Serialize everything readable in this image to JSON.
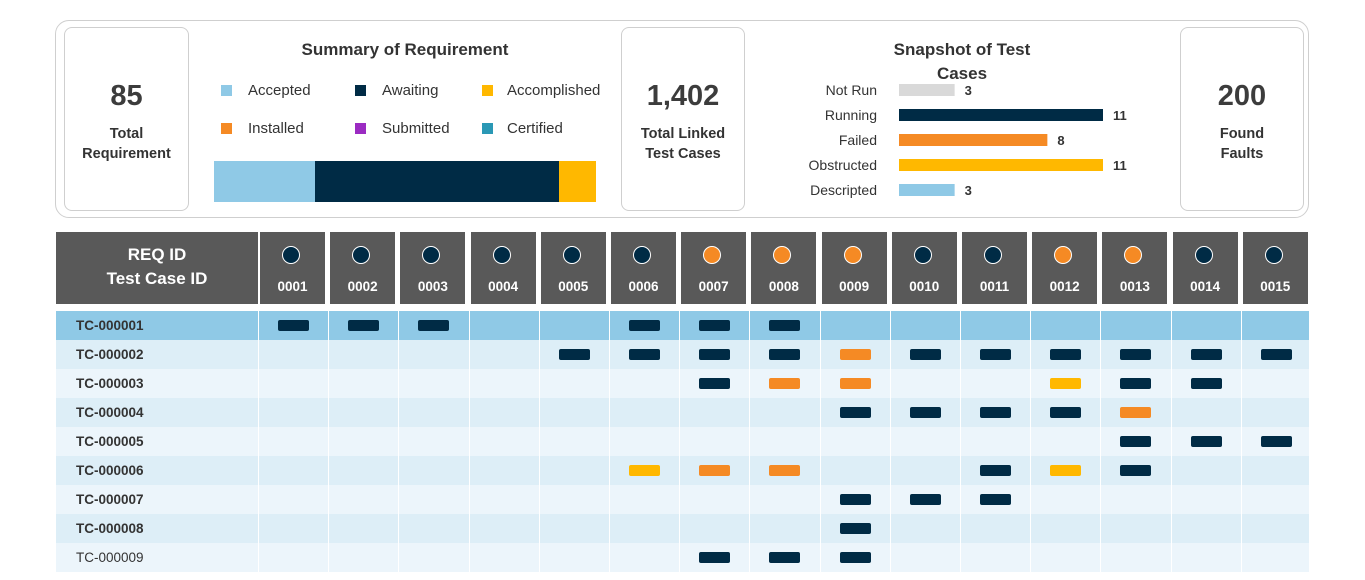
{
  "colors": {
    "accepted": "#8fc9e6",
    "awaiting": "#002b45",
    "accomplished": "#ffb800",
    "installed": "#f58a24",
    "submitted": "#9b2bc2",
    "certified": "#2a98b5",
    "not_run": "#d9d9d9",
    "header_bg": "#595959",
    "row_even": "#ddeef7",
    "row_odd": "#ecf5fb",
    "row_highlight": "#8fc9e6"
  },
  "kpis": [
    {
      "value": "85",
      "label": "Total Requirement"
    },
    {
      "value": "1,402",
      "label": "Total Linked Test Cases"
    },
    {
      "value": "200",
      "label": "Found Faults"
    }
  ],
  "summary": {
    "title": "Summary of Requirement",
    "legend": [
      {
        "label": "Accepted",
        "color": "#8fc9e6"
      },
      {
        "label": "Awaiting",
        "color": "#002b45"
      },
      {
        "label": "Accomplished",
        "color": "#ffb800"
      },
      {
        "label": "Installed",
        "color": "#f58a24"
      },
      {
        "label": "Submitted",
        "color": "#9b2bc2"
      },
      {
        "label": "Certified",
        "color": "#2a98b5"
      }
    ]
  },
  "snapshot": {
    "title": "Snapshot of Test Cases"
  },
  "chart_data": [
    {
      "type": "bar",
      "orientation": "horizontal",
      "stacked": true,
      "title": "Summary of Requirement",
      "series": [
        {
          "name": "Accepted",
          "values": [
            22
          ]
        },
        {
          "name": "Awaiting",
          "values": [
            53
          ]
        },
        {
          "name": "Accomplished",
          "values": [
            8
          ]
        },
        {
          "name": "Installed",
          "values": [
            0
          ]
        },
        {
          "name": "Submitted",
          "values": [
            0
          ]
        },
        {
          "name": "Certified",
          "values": [
            0
          ]
        }
      ],
      "legend": "top"
    },
    {
      "type": "bar",
      "orientation": "horizontal",
      "title": "Snapshot of Test Cases",
      "categories": [
        "Not Run",
        "Running",
        "Failed",
        "Obstructed",
        "Descripted"
      ],
      "values": [
        3,
        11,
        8,
        11,
        3
      ],
      "colors": [
        "#d9d9d9",
        "#002b45",
        "#f58a24",
        "#ffb800",
        "#8fc9e6"
      ],
      "xlim": [
        0,
        11
      ],
      "data_labels": true,
      "grid": false
    }
  ],
  "matrix": {
    "header_line1": "REQ ID",
    "header_line2": "Test Case ID",
    "req_ids": [
      "0001",
      "0002",
      "0003",
      "0004",
      "0005",
      "0006",
      "0007",
      "0008",
      "0009",
      "0010",
      "0011",
      "0012",
      "0013",
      "0014",
      "0015"
    ],
    "req_status": [
      "awaiting",
      "awaiting",
      "awaiting",
      "awaiting",
      "awaiting",
      "awaiting",
      "installed",
      "installed",
      "installed",
      "awaiting",
      "awaiting",
      "installed",
      "installed",
      "awaiting",
      "awaiting"
    ],
    "rows": [
      {
        "id": "TC-000001",
        "bold": true,
        "highlight": true,
        "cells": [
          "awaiting",
          "awaiting",
          "awaiting",
          "",
          "",
          "awaiting",
          "awaiting",
          "awaiting",
          "",
          "",
          "",
          "",
          "",
          "",
          ""
        ]
      },
      {
        "id": "TC-000002",
        "bold": true,
        "highlight": false,
        "cells": [
          "",
          "",
          "",
          "",
          "awaiting",
          "awaiting",
          "awaiting",
          "awaiting",
          "installed",
          "awaiting",
          "awaiting",
          "awaiting",
          "awaiting",
          "awaiting",
          "awaiting"
        ]
      },
      {
        "id": "TC-000003",
        "bold": true,
        "highlight": false,
        "cells": [
          "",
          "",
          "",
          "",
          "",
          "",
          "awaiting",
          "installed",
          "installed",
          "",
          "",
          "accomplished",
          "awaiting",
          "awaiting",
          ""
        ]
      },
      {
        "id": "TC-000004",
        "bold": true,
        "highlight": false,
        "cells": [
          "",
          "",
          "",
          "",
          "",
          "",
          "",
          "",
          "awaiting",
          "awaiting",
          "awaiting",
          "awaiting",
          "installed",
          "",
          ""
        ]
      },
      {
        "id": "TC-000005",
        "bold": true,
        "highlight": false,
        "cells": [
          "",
          "",
          "",
          "",
          "",
          "",
          "",
          "",
          "",
          "",
          "",
          "",
          "awaiting",
          "awaiting",
          "awaiting"
        ]
      },
      {
        "id": "TC-000006",
        "bold": true,
        "highlight": false,
        "cells": [
          "",
          "",
          "",
          "",
          "",
          "accomplished",
          "installed",
          "installed",
          "",
          "",
          "awaiting",
          "accomplished",
          "awaiting",
          "",
          ""
        ]
      },
      {
        "id": "TC-000007",
        "bold": true,
        "highlight": false,
        "cells": [
          "",
          "",
          "",
          "",
          "",
          "",
          "",
          "",
          "awaiting",
          "awaiting",
          "awaiting",
          "",
          "",
          "",
          ""
        ]
      },
      {
        "id": "TC-000008",
        "bold": true,
        "highlight": false,
        "cells": [
          "",
          "",
          "",
          "",
          "",
          "",
          "",
          "",
          "awaiting",
          "",
          "",
          "",
          "",
          "",
          ""
        ]
      },
      {
        "id": "TC-000009",
        "bold": false,
        "highlight": false,
        "cells": [
          "",
          "",
          "",
          "",
          "",
          "",
          "awaiting",
          "awaiting",
          "awaiting",
          "",
          "",
          "",
          "",
          "",
          ""
        ]
      }
    ]
  }
}
